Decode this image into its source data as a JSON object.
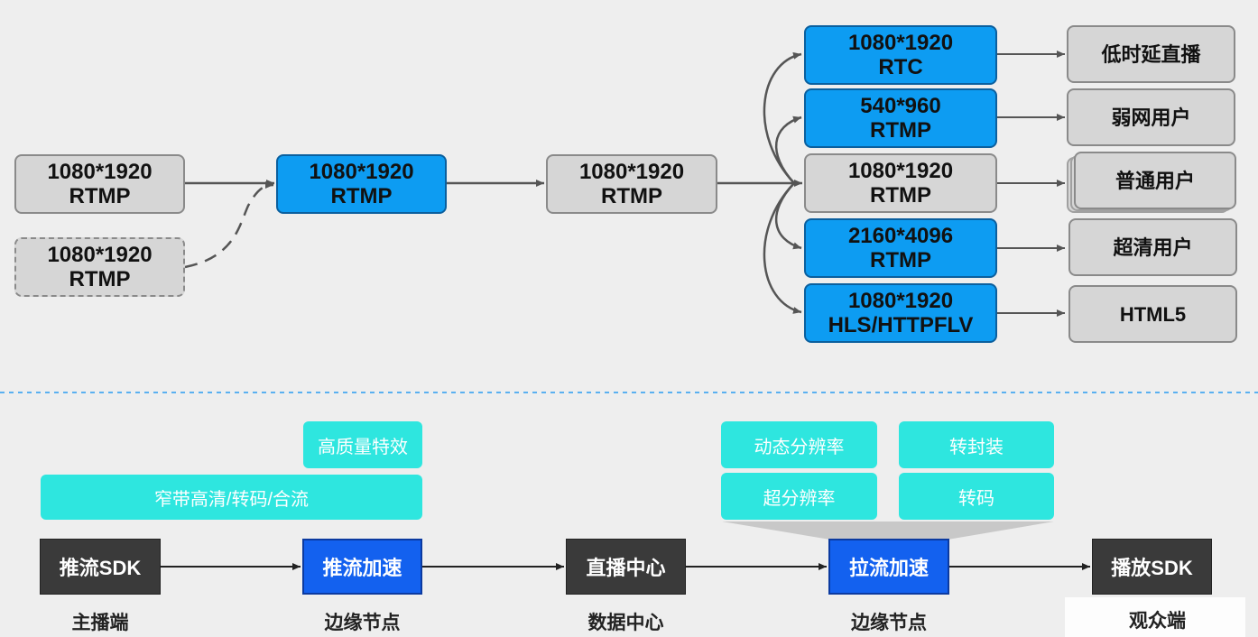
{
  "top_flow": {
    "source_main": {
      "line1": "1080*1920",
      "line2": "RTMP"
    },
    "source_backup": {
      "line1": "1080*1920",
      "line2": "RTMP"
    },
    "edge_push": {
      "line1": "1080*1920",
      "line2": "RTMP"
    },
    "center": {
      "line1": "1080*1920",
      "line2": "RTMP"
    },
    "outputs": [
      {
        "line1": "1080*1920",
        "line2": "RTC",
        "style": "blue",
        "target": "低时延直播"
      },
      {
        "line1": "540*960",
        "line2": "RTMP",
        "style": "blue",
        "target": "弱网用户"
      },
      {
        "line1": "1080*1920",
        "line2": "RTMP",
        "style": "grey",
        "target": "普通用户"
      },
      {
        "line1": "2160*4096",
        "line2": "RTMP",
        "style": "blue",
        "target": "超清用户"
      },
      {
        "line1": "1080*1920",
        "line2": "HLS/HTTPFLV",
        "style": "blue",
        "target": "HTML5"
      }
    ]
  },
  "bottom_flow": {
    "features_push": {
      "top": "高质量特效",
      "wide": "窄带高清/转码/合流"
    },
    "features_pull": [
      "动态分辨率",
      "转封装",
      "超分辨率",
      "转码"
    ],
    "nodes": [
      {
        "label": "推流SDK",
        "caption": "主播端"
      },
      {
        "label": "推流加速",
        "caption": "边缘节点"
      },
      {
        "label": "直播中心",
        "caption": "数据中心"
      },
      {
        "label": "拉流加速",
        "caption": "边缘节点"
      },
      {
        "label": "播放SDK",
        "caption": "观众端"
      }
    ]
  },
  "colors": {
    "blue_box": "#0d9cf2",
    "grey_box": "#d6d6d6",
    "teal": "#2ee6df",
    "accel": "#1361ef",
    "dark": "#3a3a3a",
    "divider": "#5ab0f0"
  }
}
